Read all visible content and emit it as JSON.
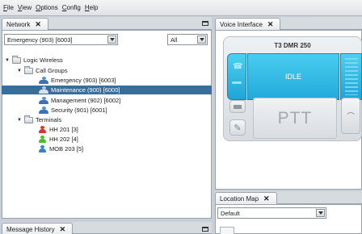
{
  "menu": [
    "File",
    "View",
    "Options",
    "Config",
    "Help"
  ],
  "network_panel": {
    "tab_label": "Network",
    "group_select": "Emergency (903) [6003]",
    "filter_select": "All",
    "tree": {
      "root": "Logic Wireless",
      "call_groups_label": "Call Groups",
      "call_groups": [
        "Emergency (903) [6003]",
        "Maintenance (900) [6000]",
        "Management (902) [6002]",
        "Security (901) [6001]"
      ],
      "terminals_label": "Terminals",
      "terminals": [
        "HH 201 [3]",
        "HH 202 [4]",
        "MOB 203 [5]"
      ]
    }
  },
  "message_history_panel": {
    "tab_label": "Message History"
  },
  "voice_panel": {
    "tab_label": "Voice Interface",
    "device_model": "T3 DMR 250",
    "display_status": "IDLE",
    "ptt_label": "PTT"
  },
  "location_panel": {
    "tab_label": "Location Map",
    "map_select": "Default"
  },
  "colors": {
    "selection": "#3a6e99",
    "screen": "#2ab4e2",
    "terminal_hh201": "#d9342b",
    "terminal_hh202": "#4cbb2f",
    "terminal_mob203": "#3a7fcf"
  }
}
